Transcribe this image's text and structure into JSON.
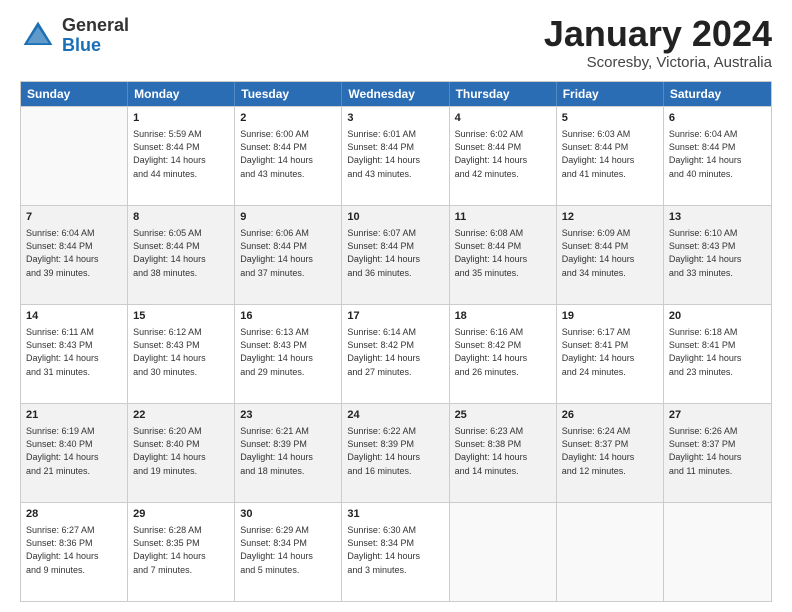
{
  "header": {
    "logo_general": "General",
    "logo_blue": "Blue",
    "month_title": "January 2024",
    "subtitle": "Scoresby, Victoria, Australia"
  },
  "calendar": {
    "days_of_week": [
      "Sunday",
      "Monday",
      "Tuesday",
      "Wednesday",
      "Thursday",
      "Friday",
      "Saturday"
    ],
    "rows": [
      [
        {
          "day": "",
          "lines": [],
          "empty": true
        },
        {
          "day": "1",
          "lines": [
            "Sunrise: 5:59 AM",
            "Sunset: 8:44 PM",
            "Daylight: 14 hours",
            "and 44 minutes."
          ]
        },
        {
          "day": "2",
          "lines": [
            "Sunrise: 6:00 AM",
            "Sunset: 8:44 PM",
            "Daylight: 14 hours",
            "and 43 minutes."
          ]
        },
        {
          "day": "3",
          "lines": [
            "Sunrise: 6:01 AM",
            "Sunset: 8:44 PM",
            "Daylight: 14 hours",
            "and 43 minutes."
          ]
        },
        {
          "day": "4",
          "lines": [
            "Sunrise: 6:02 AM",
            "Sunset: 8:44 PM",
            "Daylight: 14 hours",
            "and 42 minutes."
          ]
        },
        {
          "day": "5",
          "lines": [
            "Sunrise: 6:03 AM",
            "Sunset: 8:44 PM",
            "Daylight: 14 hours",
            "and 41 minutes."
          ]
        },
        {
          "day": "6",
          "lines": [
            "Sunrise: 6:04 AM",
            "Sunset: 8:44 PM",
            "Daylight: 14 hours",
            "and 40 minutes."
          ]
        }
      ],
      [
        {
          "day": "7",
          "lines": [
            "Sunrise: 6:04 AM",
            "Sunset: 8:44 PM",
            "Daylight: 14 hours",
            "and 39 minutes."
          ],
          "shaded": true
        },
        {
          "day": "8",
          "lines": [
            "Sunrise: 6:05 AM",
            "Sunset: 8:44 PM",
            "Daylight: 14 hours",
            "and 38 minutes."
          ],
          "shaded": true
        },
        {
          "day": "9",
          "lines": [
            "Sunrise: 6:06 AM",
            "Sunset: 8:44 PM",
            "Daylight: 14 hours",
            "and 37 minutes."
          ],
          "shaded": true
        },
        {
          "day": "10",
          "lines": [
            "Sunrise: 6:07 AM",
            "Sunset: 8:44 PM",
            "Daylight: 14 hours",
            "and 36 minutes."
          ],
          "shaded": true
        },
        {
          "day": "11",
          "lines": [
            "Sunrise: 6:08 AM",
            "Sunset: 8:44 PM",
            "Daylight: 14 hours",
            "and 35 minutes."
          ],
          "shaded": true
        },
        {
          "day": "12",
          "lines": [
            "Sunrise: 6:09 AM",
            "Sunset: 8:44 PM",
            "Daylight: 14 hours",
            "and 34 minutes."
          ],
          "shaded": true
        },
        {
          "day": "13",
          "lines": [
            "Sunrise: 6:10 AM",
            "Sunset: 8:43 PM",
            "Daylight: 14 hours",
            "and 33 minutes."
          ],
          "shaded": true
        }
      ],
      [
        {
          "day": "14",
          "lines": [
            "Sunrise: 6:11 AM",
            "Sunset: 8:43 PM",
            "Daylight: 14 hours",
            "and 31 minutes."
          ]
        },
        {
          "day": "15",
          "lines": [
            "Sunrise: 6:12 AM",
            "Sunset: 8:43 PM",
            "Daylight: 14 hours",
            "and 30 minutes."
          ]
        },
        {
          "day": "16",
          "lines": [
            "Sunrise: 6:13 AM",
            "Sunset: 8:43 PM",
            "Daylight: 14 hours",
            "and 29 minutes."
          ]
        },
        {
          "day": "17",
          "lines": [
            "Sunrise: 6:14 AM",
            "Sunset: 8:42 PM",
            "Daylight: 14 hours",
            "and 27 minutes."
          ]
        },
        {
          "day": "18",
          "lines": [
            "Sunrise: 6:16 AM",
            "Sunset: 8:42 PM",
            "Daylight: 14 hours",
            "and 26 minutes."
          ]
        },
        {
          "day": "19",
          "lines": [
            "Sunrise: 6:17 AM",
            "Sunset: 8:41 PM",
            "Daylight: 14 hours",
            "and 24 minutes."
          ]
        },
        {
          "day": "20",
          "lines": [
            "Sunrise: 6:18 AM",
            "Sunset: 8:41 PM",
            "Daylight: 14 hours",
            "and 23 minutes."
          ]
        }
      ],
      [
        {
          "day": "21",
          "lines": [
            "Sunrise: 6:19 AM",
            "Sunset: 8:40 PM",
            "Daylight: 14 hours",
            "and 21 minutes."
          ],
          "shaded": true
        },
        {
          "day": "22",
          "lines": [
            "Sunrise: 6:20 AM",
            "Sunset: 8:40 PM",
            "Daylight: 14 hours",
            "and 19 minutes."
          ],
          "shaded": true
        },
        {
          "day": "23",
          "lines": [
            "Sunrise: 6:21 AM",
            "Sunset: 8:39 PM",
            "Daylight: 14 hours",
            "and 18 minutes."
          ],
          "shaded": true
        },
        {
          "day": "24",
          "lines": [
            "Sunrise: 6:22 AM",
            "Sunset: 8:39 PM",
            "Daylight: 14 hours",
            "and 16 minutes."
          ],
          "shaded": true
        },
        {
          "day": "25",
          "lines": [
            "Sunrise: 6:23 AM",
            "Sunset: 8:38 PM",
            "Daylight: 14 hours",
            "and 14 minutes."
          ],
          "shaded": true
        },
        {
          "day": "26",
          "lines": [
            "Sunrise: 6:24 AM",
            "Sunset: 8:37 PM",
            "Daylight: 14 hours",
            "and 12 minutes."
          ],
          "shaded": true
        },
        {
          "day": "27",
          "lines": [
            "Sunrise: 6:26 AM",
            "Sunset: 8:37 PM",
            "Daylight: 14 hours",
            "and 11 minutes."
          ],
          "shaded": true
        }
      ],
      [
        {
          "day": "28",
          "lines": [
            "Sunrise: 6:27 AM",
            "Sunset: 8:36 PM",
            "Daylight: 14 hours",
            "and 9 minutes."
          ]
        },
        {
          "day": "29",
          "lines": [
            "Sunrise: 6:28 AM",
            "Sunset: 8:35 PM",
            "Daylight: 14 hours",
            "and 7 minutes."
          ]
        },
        {
          "day": "30",
          "lines": [
            "Sunrise: 6:29 AM",
            "Sunset: 8:34 PM",
            "Daylight: 14 hours",
            "and 5 minutes."
          ]
        },
        {
          "day": "31",
          "lines": [
            "Sunrise: 6:30 AM",
            "Sunset: 8:34 PM",
            "Daylight: 14 hours",
            "and 3 minutes."
          ]
        },
        {
          "day": "",
          "lines": [],
          "empty": true
        },
        {
          "day": "",
          "lines": [],
          "empty": true
        },
        {
          "day": "",
          "lines": [],
          "empty": true
        }
      ]
    ]
  }
}
